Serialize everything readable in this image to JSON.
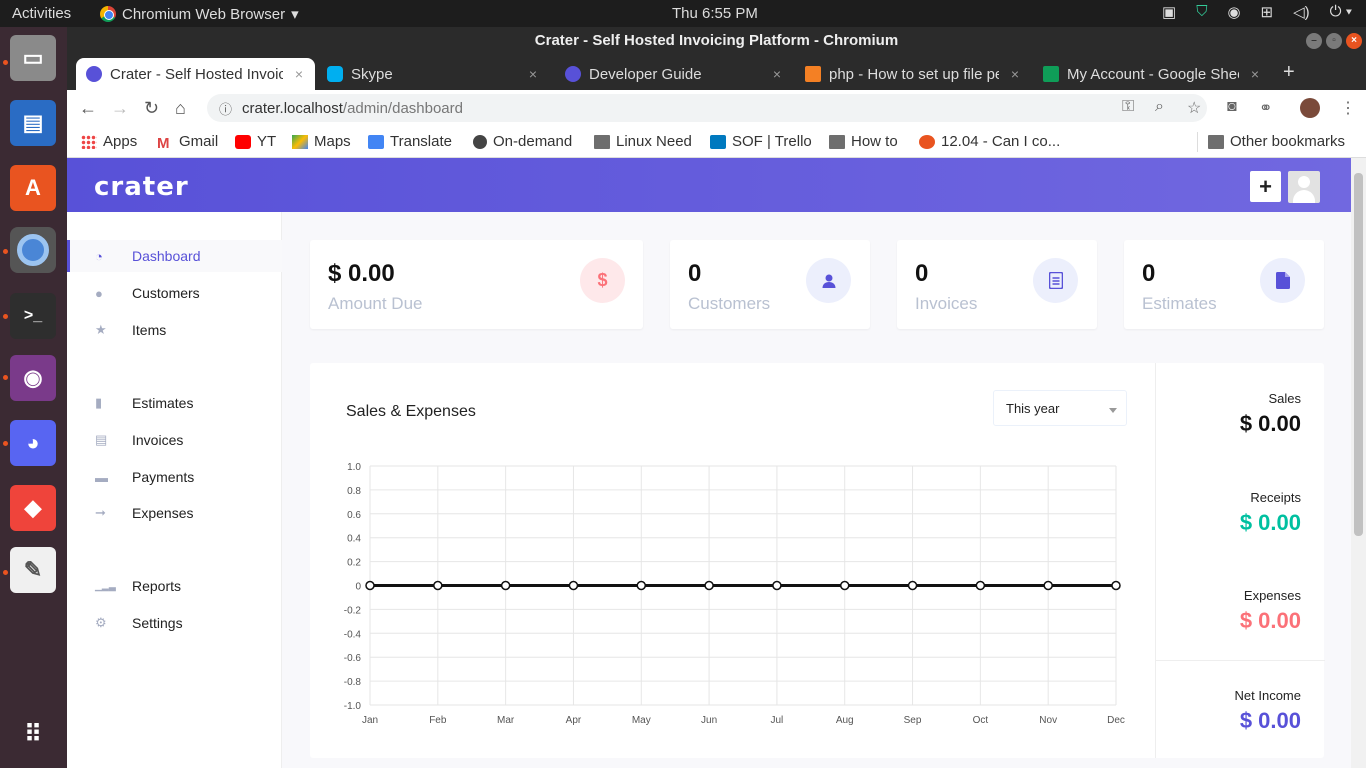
{
  "topbar": {
    "activities": "Activities",
    "app_name": "Chromium Web Browser",
    "clock": "Thu  6:55 PM"
  },
  "window": {
    "title": "Crater - Self Hosted Invoicing Platform - Chromium"
  },
  "tabs": [
    {
      "title": "Crater - Self Hosted Invoic",
      "favicon_color": "#5851d8"
    },
    {
      "title": "Skype",
      "favicon_color": "#00aff0"
    },
    {
      "title": "Developer Guide",
      "favicon_color": "#5851d8"
    },
    {
      "title": "php - How to set up file pe",
      "favicon_color": "#f48024"
    },
    {
      "title": "My Account - Google Shee",
      "favicon_color": "#0f9d58"
    }
  ],
  "omnibox": {
    "host": "crater.localhost",
    "path": "/admin/dashboard"
  },
  "bookmarks": [
    {
      "label": "Apps",
      "icon": "apps-grid-icon"
    },
    {
      "label": "Gmail",
      "icon": "gmail-icon"
    },
    {
      "label": "YT",
      "icon": "youtube-icon"
    },
    {
      "label": "Maps",
      "icon": "maps-icon"
    },
    {
      "label": "Translate",
      "icon": "translate-icon"
    },
    {
      "label": "On-demand",
      "icon": "globe-icon"
    },
    {
      "label": "Linux Need",
      "icon": "folder-icon"
    },
    {
      "label": "SOF | Trello",
      "icon": "trello-icon"
    },
    {
      "label": "How to",
      "icon": "folder-icon"
    },
    {
      "label": "12.04 - Can I co...",
      "icon": "askubuntu-icon"
    }
  ],
  "other_bookmarks": "Other bookmarks",
  "app": {
    "logo": "crater",
    "plus_label": "+",
    "sidebar": [
      {
        "label": "Dashboard",
        "icon": "dashboard-icon",
        "glyph": "◔",
        "active": true
      },
      {
        "label": "Customers",
        "icon": "user-icon",
        "glyph": "●"
      },
      {
        "label": "Items",
        "icon": "star-icon",
        "glyph": "★"
      },
      {
        "label": "Estimates",
        "icon": "document-icon",
        "glyph": "▮"
      },
      {
        "label": "Invoices",
        "icon": "invoice-icon",
        "glyph": "▤"
      },
      {
        "label": "Payments",
        "icon": "credit-card-icon",
        "glyph": "▬"
      },
      {
        "label": "Expenses",
        "icon": "expenses-icon",
        "glyph": "➞"
      },
      {
        "label": "Reports",
        "icon": "signal-icon",
        "glyph": "▁▂▃"
      },
      {
        "label": "Settings",
        "icon": "gear-icon",
        "glyph": "⚙"
      }
    ],
    "cards": [
      {
        "value": "$ 0.00",
        "label": "Amount Due",
        "icon_glyph": "$",
        "icon_color": "#fb7178",
        "icon_bg": "#fee8ea"
      },
      {
        "value": "0",
        "label": "Customers",
        "icon_glyph": "👤",
        "icon_color": "#5851d8",
        "icon_bg": "#eceffc"
      },
      {
        "value": "0",
        "label": "Invoices",
        "icon_glyph": "▤",
        "icon_color": "#5851d8",
        "icon_bg": "#eceffc"
      },
      {
        "value": "0",
        "label": "Estimates",
        "icon_glyph": "▮",
        "icon_color": "#5851d8",
        "icon_bg": "#eceffc"
      }
    ],
    "chart_title": "Sales & Expenses",
    "period": "This year",
    "stats": [
      {
        "label": "Sales",
        "value": "$ 0.00",
        "color": "#111111"
      },
      {
        "label": "Receipts",
        "value": "$ 0.00",
        "color": "#00c0a0"
      },
      {
        "label": "Expenses",
        "value": "$ 0.00",
        "color": "#fb7178"
      },
      {
        "label": "Net Income",
        "value": "$ 0.00",
        "color": "#5851d8"
      }
    ]
  },
  "chart_data": {
    "type": "line",
    "categories": [
      "Jan",
      "Feb",
      "Mar",
      "Apr",
      "May",
      "Jun",
      "Jul",
      "Aug",
      "Sep",
      "Oct",
      "Nov",
      "Dec"
    ],
    "series": [
      {
        "values": [
          0,
          0,
          0,
          0,
          0,
          0,
          0,
          0,
          0,
          0,
          0,
          0
        ]
      }
    ],
    "ylim": [
      -1.0,
      1.0
    ],
    "yticks": [
      "1.0",
      "0.8",
      "0.6",
      "0.4",
      "0.2",
      "0",
      "-0.2",
      "-0.4",
      "-0.6",
      "-0.8",
      "-1.0"
    ],
    "grid": true
  }
}
